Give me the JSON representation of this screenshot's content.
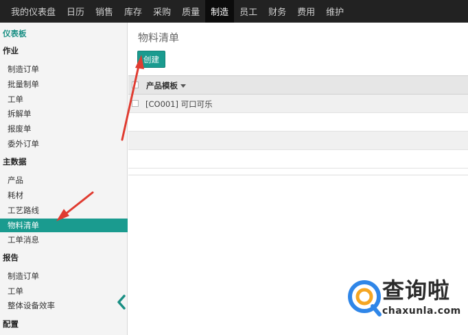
{
  "topnav": {
    "items": [
      {
        "label": "我的仪表盘",
        "active": false
      },
      {
        "label": "日历",
        "active": false
      },
      {
        "label": "销售",
        "active": false
      },
      {
        "label": "库存",
        "active": false
      },
      {
        "label": "采购",
        "active": false
      },
      {
        "label": "质量",
        "active": false
      },
      {
        "label": "制造",
        "active": true
      },
      {
        "label": "员工",
        "active": false
      },
      {
        "label": "财务",
        "active": false
      },
      {
        "label": "费用",
        "active": false
      },
      {
        "label": "维护",
        "active": false
      }
    ]
  },
  "sidebar": {
    "dashboard": "仪表板",
    "operations": {
      "heading": "作业",
      "items": [
        "制造订单",
        "批量制单",
        "工单",
        "拆解单",
        "报废单",
        "委外订单"
      ]
    },
    "master_data": {
      "heading": "主数据",
      "items": [
        "产品",
        "耗材",
        "工艺路线",
        "物料清单",
        "工单消息"
      ],
      "active_item": "物料清单"
    },
    "reports": {
      "heading": "报告",
      "items": [
        "制造订单",
        "工单",
        "整体设备效率"
      ]
    },
    "config": {
      "heading": "配置"
    }
  },
  "main": {
    "title": "物料清单",
    "create_label": "创建",
    "list": {
      "column": "产品模板",
      "rows": [
        "[CO001] 可口可乐"
      ]
    }
  },
  "watermark": {
    "brand": "查询啦",
    "domain": "chaxunla.com"
  },
  "colors": {
    "accent": "#1a9b8f",
    "topbar": "#222222",
    "arrow": "#e03c31",
    "watermark_blue": "#2f86e8",
    "watermark_orange": "#f5a623"
  }
}
